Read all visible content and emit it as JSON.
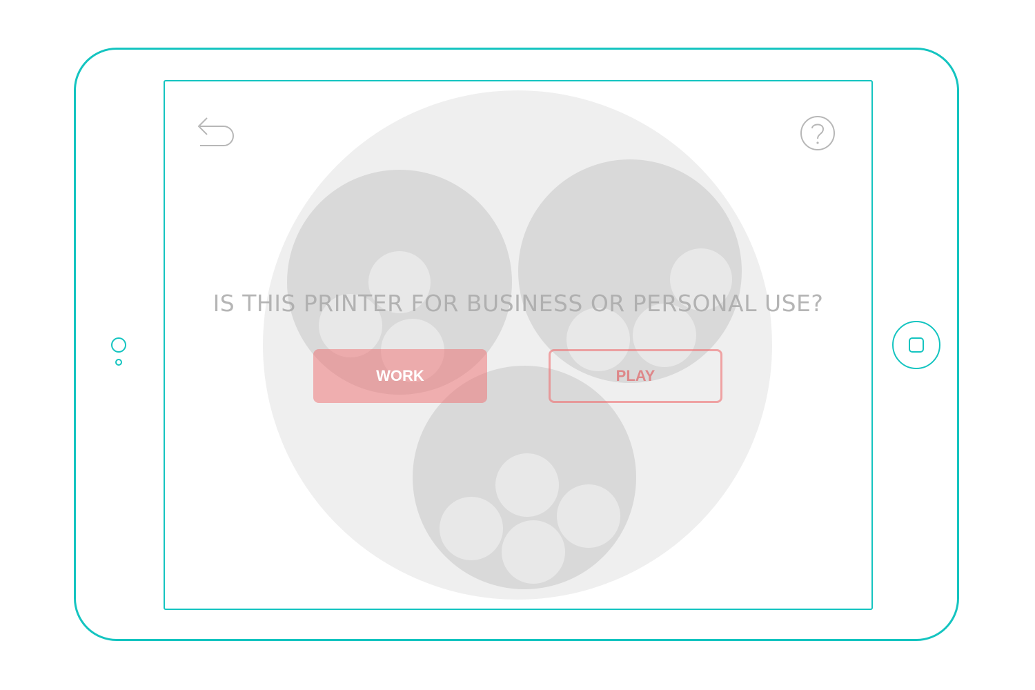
{
  "colors": {
    "device_outline": "#14c4c0",
    "overlay_outer_circle": "#efefef",
    "overlay_group_circle": "#d9d9d9",
    "overlay_item_circle": "#e8e8e8",
    "question_text": "#a9a9a9",
    "work_button_fill": "#f2aeaf",
    "play_button_outline": "#ef6e70"
  },
  "icons": {
    "back": "back-arrow-icon",
    "help": "question-mark-circle-icon",
    "home": "home-button-icon",
    "camera": "front-camera-icon"
  },
  "screen": {
    "question": "IS THIS PRINTER FOR BUSINESS OR PERSONAL USE?",
    "buttons": {
      "work_label": "WORK",
      "play_label": "PLAY"
    }
  }
}
